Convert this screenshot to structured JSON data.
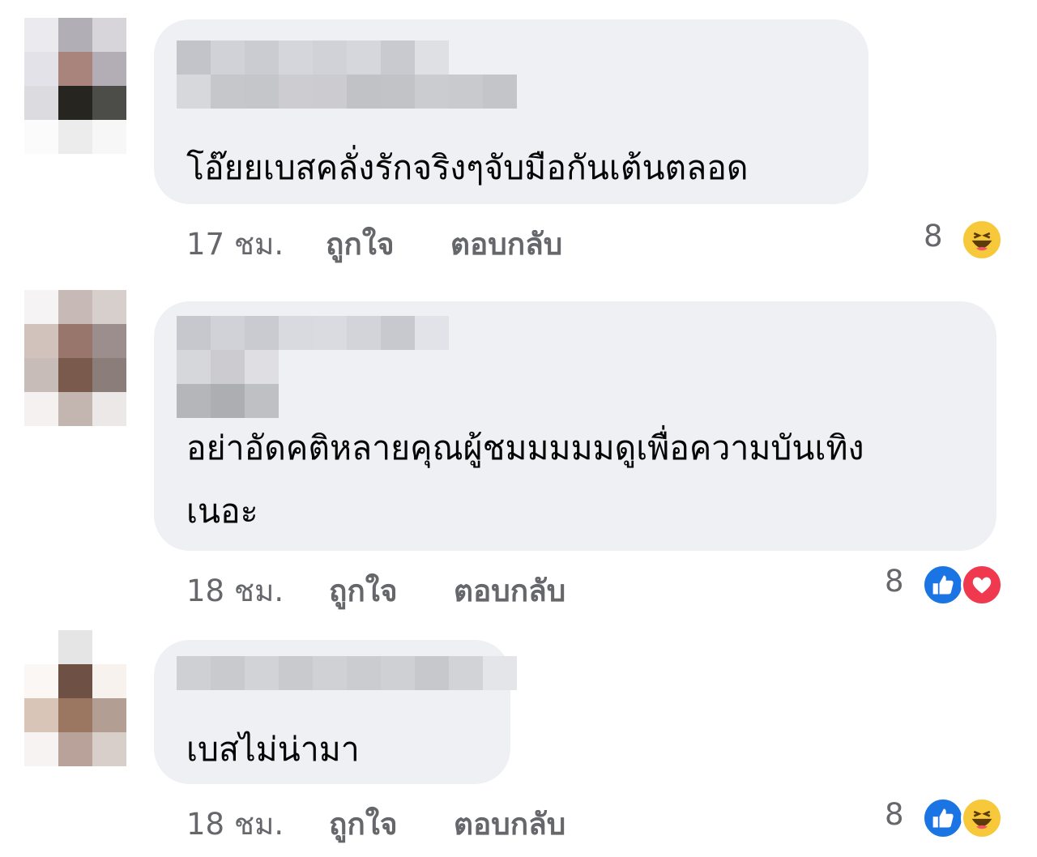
{
  "comments": [
    {
      "text_lines": [
        "โอ๊ยยเบสคลั่งรักจริงๆจับมือกันเต้นตลอด"
      ],
      "time": "17 ชม.",
      "like_label": "ถูกใจ",
      "reply_label": "ตอบกลับ",
      "reaction_count": "8",
      "reactions": [
        "haha"
      ]
    },
    {
      "text_lines": [
        "อย่าอัดคติหลายคุณผู้ชมมมมมดูเพื่อความบันเทิง",
        "เนอะ"
      ],
      "time": "18 ชม.",
      "like_label": "ถูกใจ",
      "reply_label": "ตอบกลับ",
      "reaction_count": "8",
      "reactions": [
        "like",
        "love"
      ]
    },
    {
      "text_lines": [
        "เบสไม่น่ามา"
      ],
      "time": "18 ชม.",
      "like_label": "ถูกใจ",
      "reply_label": "ตอบกลับ",
      "reaction_count": "8",
      "reactions": [
        "like",
        "haha"
      ]
    }
  ],
  "reaction_icons": {
    "haha": "haha-reaction-icon",
    "like": "like-reaction-icon",
    "love": "love-reaction-icon"
  },
  "colors": {
    "bubble": "#eff0f3",
    "meta_text": "#65676b",
    "like_blue": "#1b74e4",
    "love_red": "#f0384f",
    "haha_yellow": "#f7c839"
  }
}
